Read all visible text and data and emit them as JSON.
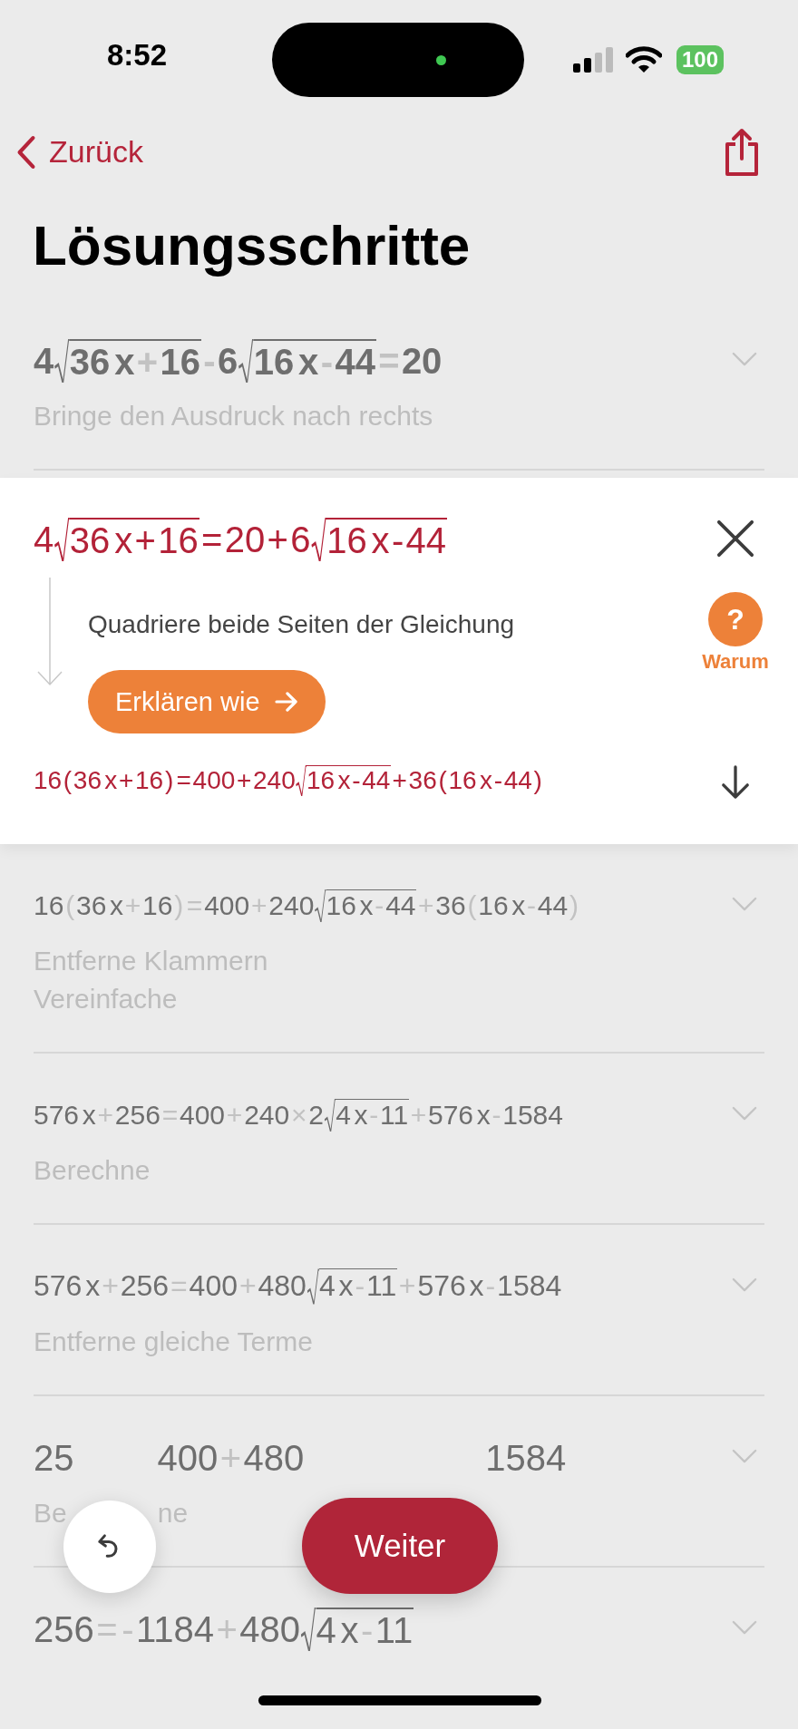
{
  "status_bar": {
    "time": "8:52",
    "battery": "100"
  },
  "nav": {
    "back": "Zurück"
  },
  "title": "Lösungsschritte",
  "steps": [
    {
      "expanded": false,
      "equation": [
        {
          "kind": "t",
          "text": "4"
        },
        {
          "kind": "r",
          "parts": [
            {
              "kind": "t",
              "text": "36"
            },
            {
              "kind": "v",
              "text": "x"
            },
            {
              "kind": "o",
              "text": "+"
            },
            {
              "kind": "t",
              "text": "16"
            }
          ]
        },
        {
          "kind": "o",
          "text": "-"
        },
        {
          "kind": "t",
          "text": "6"
        },
        {
          "kind": "r",
          "parts": [
            {
              "kind": "t",
              "text": "16"
            },
            {
              "kind": "v",
              "text": "x"
            },
            {
              "kind": "o",
              "text": "-"
            },
            {
              "kind": "t",
              "text": "44"
            }
          ]
        },
        {
          "kind": "o",
          "text": "="
        },
        {
          "kind": "t",
          "text": "20"
        }
      ],
      "captions": [
        [
          "Bringe den Ausdruck nach rechts"
        ]
      ]
    },
    {
      "expanded": true,
      "equation": [
        {
          "kind": "t",
          "text": "4"
        },
        {
          "kind": "r",
          "parts": [
            {
              "kind": "t",
              "text": "36"
            },
            {
              "kind": "v",
              "text": "x"
            },
            {
              "kind": "o",
              "text": "+"
            },
            {
              "kind": "t",
              "text": "16"
            }
          ]
        },
        {
          "kind": "o",
          "text": "="
        },
        {
          "kind": "t",
          "text": "20"
        },
        {
          "kind": "o",
          "text": "+"
        },
        {
          "kind": "t",
          "text": "6"
        },
        {
          "kind": "r",
          "parts": [
            {
              "kind": "t",
              "text": "16"
            },
            {
              "kind": "v",
              "text": "x"
            },
            {
              "kind": "o",
              "text": "-"
            },
            {
              "kind": "t",
              "text": "44"
            }
          ]
        }
      ],
      "description": "Quadriere beide Seiten der Gleichung",
      "explain_button": "Erklären wie",
      "why_icon": "?",
      "why_label": "Warum",
      "result": [
        {
          "kind": "t",
          "text": "16"
        },
        {
          "kind": "o",
          "text": "("
        },
        {
          "kind": "t",
          "text": "36"
        },
        {
          "kind": "v",
          "text": "x"
        },
        {
          "kind": "o",
          "text": "+"
        },
        {
          "kind": "t",
          "text": "16"
        },
        {
          "kind": "o",
          "text": ")"
        },
        {
          "kind": "o",
          "text": "="
        },
        {
          "kind": "t",
          "text": "400"
        },
        {
          "kind": "o",
          "text": "+"
        },
        {
          "kind": "t",
          "text": "240"
        },
        {
          "kind": "r",
          "parts": [
            {
              "kind": "t",
              "text": "16"
            },
            {
              "kind": "v",
              "text": "x"
            },
            {
              "kind": "o",
              "text": "-"
            },
            {
              "kind": "t",
              "text": "44"
            }
          ]
        },
        {
          "kind": "o",
          "text": "+"
        },
        {
          "kind": "t",
          "text": "36"
        },
        {
          "kind": "o",
          "text": "("
        },
        {
          "kind": "t",
          "text": "16"
        },
        {
          "kind": "v",
          "text": "x"
        },
        {
          "kind": "o",
          "text": "-"
        },
        {
          "kind": "t",
          "text": "44"
        },
        {
          "kind": "o",
          "text": ")"
        }
      ]
    },
    {
      "expanded": false,
      "equation": [
        {
          "kind": "t",
          "text": "16"
        },
        {
          "kind": "o",
          "text": "("
        },
        {
          "kind": "t",
          "text": "36"
        },
        {
          "kind": "v",
          "text": "x"
        },
        {
          "kind": "o",
          "text": "+"
        },
        {
          "kind": "t",
          "text": "16"
        },
        {
          "kind": "o",
          "text": ")"
        },
        {
          "kind": "o",
          "text": "="
        },
        {
          "kind": "t",
          "text": "400"
        },
        {
          "kind": "o",
          "text": "+"
        },
        {
          "kind": "t",
          "text": "240"
        },
        {
          "kind": "r",
          "parts": [
            {
              "kind": "t",
              "text": "16"
            },
            {
              "kind": "v",
              "text": "x"
            },
            {
              "kind": "o",
              "text": "-"
            },
            {
              "kind": "t",
              "text": "44"
            }
          ]
        },
        {
          "kind": "o",
          "text": "+"
        },
        {
          "kind": "t",
          "text": "36"
        },
        {
          "kind": "o",
          "text": "("
        },
        {
          "kind": "t",
          "text": "16"
        },
        {
          "kind": "v",
          "text": "x"
        },
        {
          "kind": "o",
          "text": "-"
        },
        {
          "kind": "t",
          "text": "44"
        },
        {
          "kind": "o",
          "text": ")"
        }
      ],
      "captions": [
        [
          "Entferne Klammern"
        ],
        [
          "Vereinfache"
        ]
      ]
    },
    {
      "expanded": false,
      "equation": [
        {
          "kind": "t",
          "text": "576"
        },
        {
          "kind": "v",
          "text": "x"
        },
        {
          "kind": "o",
          "text": "+"
        },
        {
          "kind": "t",
          "text": "256"
        },
        {
          "kind": "o",
          "text": "="
        },
        {
          "kind": "t",
          "text": "400"
        },
        {
          "kind": "o",
          "text": "+"
        },
        {
          "kind": "t",
          "text": "240"
        },
        {
          "kind": "o",
          "text": "×"
        },
        {
          "kind": "t",
          "text": "2"
        },
        {
          "kind": "r",
          "parts": [
            {
              "kind": "t",
              "text": "4"
            },
            {
              "kind": "v",
              "text": "x"
            },
            {
              "kind": "o",
              "text": "-"
            },
            {
              "kind": "t",
              "text": "11"
            }
          ]
        },
        {
          "kind": "o",
          "text": "+"
        },
        {
          "kind": "t",
          "text": "576"
        },
        {
          "kind": "v",
          "text": "x"
        },
        {
          "kind": "o",
          "text": "-"
        },
        {
          "kind": "t",
          "text": "1584"
        }
      ],
      "captions": [
        [
          "Berechne"
        ]
      ]
    },
    {
      "expanded": false,
      "equation": [
        {
          "kind": "t",
          "text": "576"
        },
        {
          "kind": "v",
          "text": "x"
        },
        {
          "kind": "o",
          "text": "+"
        },
        {
          "kind": "t",
          "text": "256"
        },
        {
          "kind": "o",
          "text": "="
        },
        {
          "kind": "t",
          "text": "400"
        },
        {
          "kind": "o",
          "text": "+"
        },
        {
          "kind": "t",
          "text": "480"
        },
        {
          "kind": "r",
          "parts": [
            {
              "kind": "t",
              "text": "4"
            },
            {
              "kind": "v",
              "text": "x"
            },
            {
              "kind": "o",
              "text": "-"
            },
            {
              "kind": "t",
              "text": "11"
            }
          ]
        },
        {
          "kind": "o",
          "text": "+"
        },
        {
          "kind": "t",
          "text": "576"
        },
        {
          "kind": "v",
          "text": "x"
        },
        {
          "kind": "o",
          "text": "-"
        },
        {
          "kind": "t",
          "text": "1584"
        }
      ],
      "captions": [
        [
          "Entferne gleiche Terme"
        ]
      ]
    },
    {
      "expanded": false,
      "equation": [
        {
          "kind": "t",
          "text": "25"
        },
        {
          "kind": "gap"
        },
        {
          "kind": "t",
          "text": "400"
        },
        {
          "kind": "o",
          "text": "+"
        },
        {
          "kind": "t",
          "text": "480"
        },
        {
          "kind": "gap"
        },
        {
          "kind": "t",
          "text": "1584"
        }
      ],
      "captions": [
        [
          "Be",
          "ne"
        ]
      ]
    },
    {
      "expanded": false,
      "equation": [
        {
          "kind": "t",
          "text": "256"
        },
        {
          "kind": "o",
          "text": "="
        },
        {
          "kind": "o",
          "text": "-"
        },
        {
          "kind": "t",
          "text": "1184"
        },
        {
          "kind": "o",
          "text": "+"
        },
        {
          "kind": "t",
          "text": "480"
        },
        {
          "kind": "r",
          "parts": [
            {
              "kind": "t",
              "text": "4"
            },
            {
              "kind": "v",
              "text": "x"
            },
            {
              "kind": "o",
              "text": "-"
            },
            {
              "kind": "t",
              "text": "11"
            }
          ]
        }
      ]
    }
  ],
  "next_button": "Weiter"
}
